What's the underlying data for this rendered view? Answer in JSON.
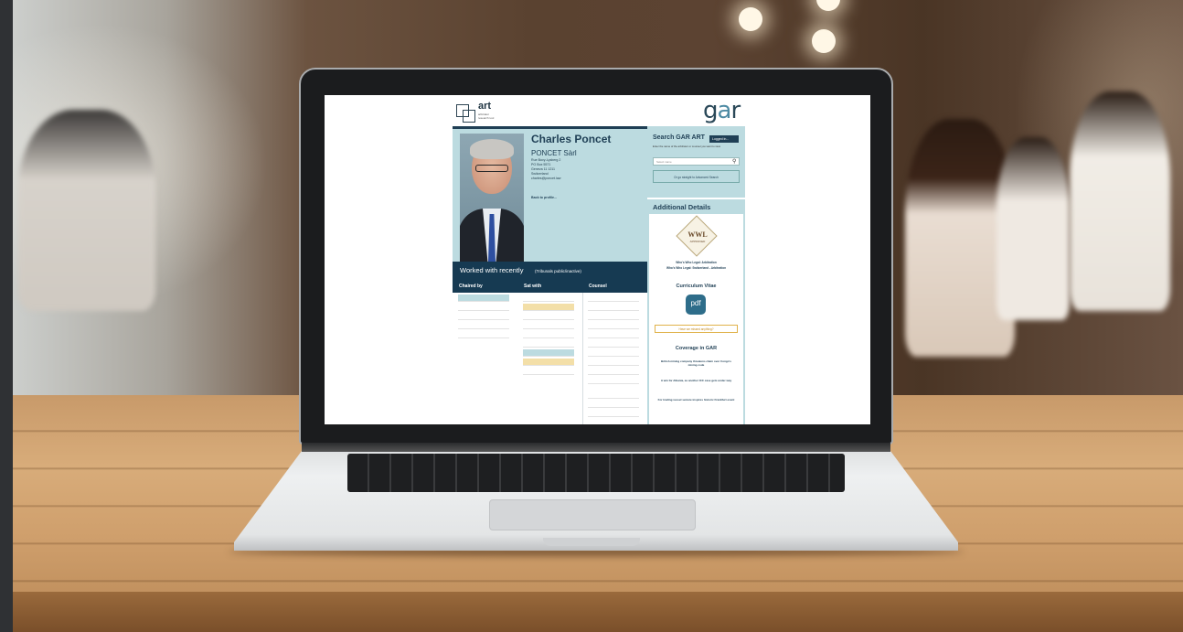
{
  "colors": {
    "accent_dark": "#163a52",
    "accent_light": "#bcdbe0",
    "highlight": "#f3dfa8"
  },
  "logos": {
    "art": "art",
    "art_sub": "arbitrator research tool",
    "gar_g": "g",
    "gar_a": "a",
    "gar_r": "r"
  },
  "profile": {
    "name": "Charles Poncet",
    "firm": "PONCET Sàrl",
    "address": [
      "Rue Bovy-Lysberg 2",
      "PO Box 5571",
      "Geneva 11 1211",
      "Switzerland",
      "charles@poncet.law"
    ],
    "back_link": "Back to profile..."
  },
  "worked": {
    "title": "Worked with recently",
    "subtitle": "(Tribunals public/inactive)",
    "columns": [
      "Chaired by",
      "Sat with",
      "Counsel"
    ]
  },
  "search": {
    "title": "Search GAR ART",
    "login_label": "Logged in...",
    "hint": "Enter the name of the arbitrator or counsel you want to view",
    "placeholder": "Select name",
    "advanced": "Or go straight to Advanced Search"
  },
  "sidebar": {
    "title": "Additional Details",
    "badge_text": "WWL",
    "badge_sub": "APPROVED",
    "wwl_line1": "Who's Who Legal: Arbitration",
    "wwl_line2": "Who's Who Legal: Switzerland - Arbitration",
    "cv_title": "Curriculum Vitae",
    "pdf_label": "pdf",
    "missed": "Have we missed anything?",
    "coverage_title": "Coverage in GAR",
    "news": [
      "British mining company threatens claim over Congo's mining code",
      "A win for Albania, as another ICC case gets under way",
      "For trading vessel seizure inspires historic Frankfurt event"
    ]
  }
}
